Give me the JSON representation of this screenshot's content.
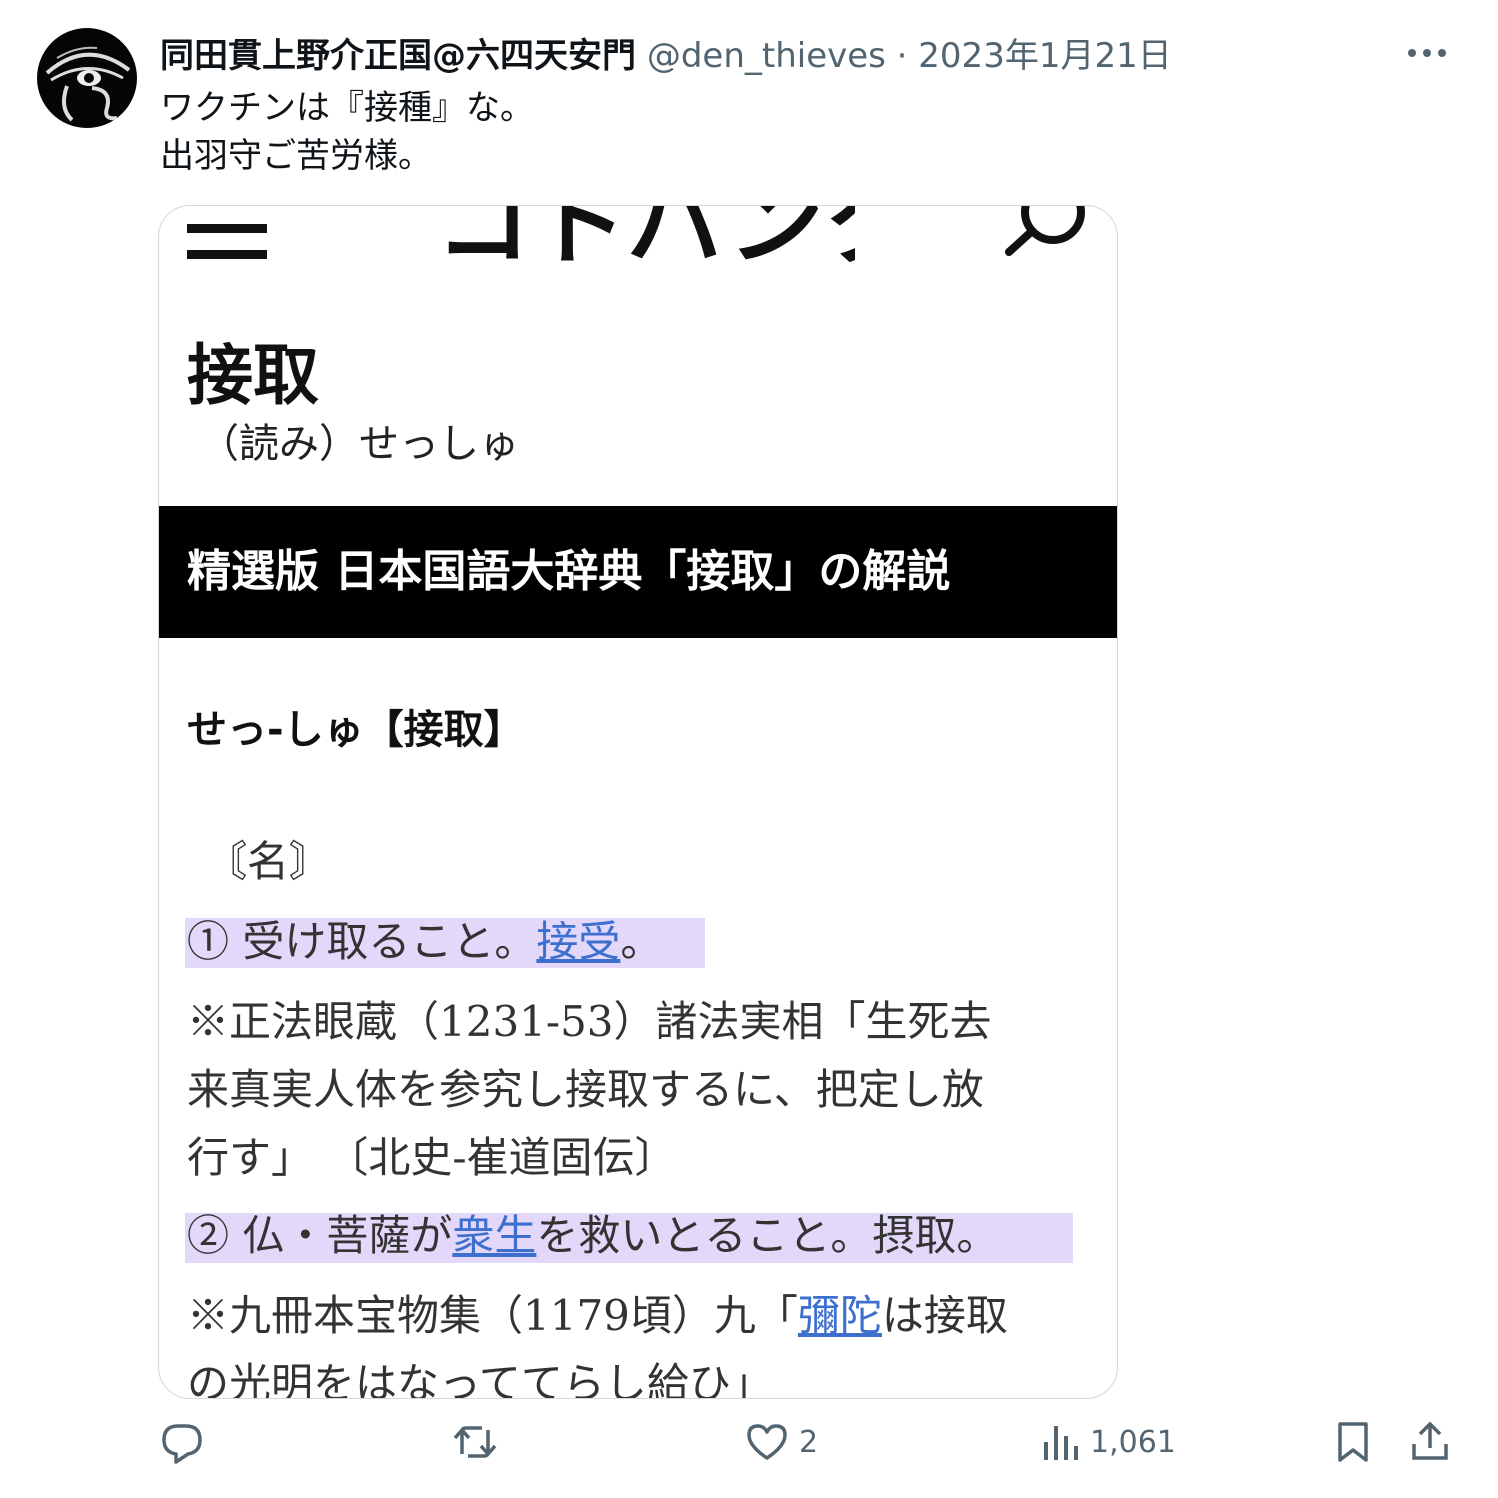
{
  "tweet": {
    "display_name": "同田貫上野介正国@六四天安門",
    "handle": "@den_thieves",
    "date": "2023年1月21日",
    "text_lines": [
      "ワクチンは『接種』な。",
      "出羽守ご苦労様。"
    ]
  },
  "card": {
    "logo_text": "コトバンク",
    "title": "接取",
    "reading": "（読み）せっしゅ",
    "banner": "精選版 日本国語大辞典「接取」の解説",
    "headword": "せっ-しゅ【接取】",
    "pos": "〘名〙",
    "def1_pre": "① 受け取ること。",
    "def1_link": "接受",
    "def1_post": "。",
    "quote1_lines": [
      "※正法眼蔵（1231‐53）諸法実相「生死去",
      "来真実人体を参究し接取するに、把定し放",
      "行す」 〔北史‐崔道固伝〕"
    ],
    "def2_pre": "② 仏・菩薩が",
    "def2_link": "衆生",
    "def2_post": "を救いとること。摂取。",
    "quote2_pre": "※九冊本宝物集（1179頃）九「",
    "quote2_link": "彌陀",
    "quote2_post": "は接取",
    "quote2_line2": "の光明をはなっててらし給ひ」"
  },
  "actions": {
    "replies": "",
    "retweets": "",
    "likes": "2",
    "views": "1,061"
  },
  "colors": {
    "highlight": "#e3d7fa",
    "link": "#3d6fcf",
    "meta": "#536471"
  }
}
